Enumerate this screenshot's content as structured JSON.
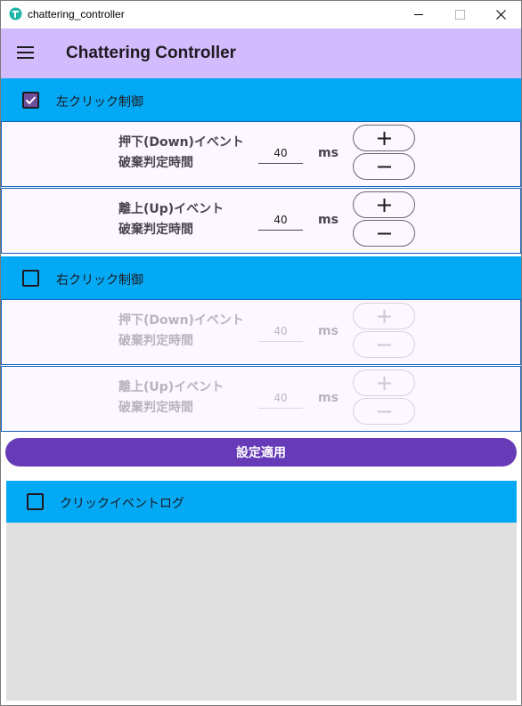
{
  "window": {
    "title": "chattering_controller",
    "icon": "app-logo-icon",
    "controls": [
      "minimize-icon",
      "maximize-icon",
      "close-icon"
    ]
  },
  "appbar": {
    "menu_icon": "menu-icon",
    "title": "Chattering Controller",
    "background": "#d3bcfd"
  },
  "left_click": {
    "label": "左クリック制御",
    "checked": true,
    "down": {
      "label_line1": "押下(Down)イベント",
      "label_line2": "破棄判定時間",
      "value": "40",
      "unit": "ms"
    },
    "up": {
      "label_line1": "離上(Up)イベント",
      "label_line2": "破棄判定時間",
      "value": "40",
      "unit": "ms"
    }
  },
  "right_click": {
    "label": "右クリック制御",
    "checked": false,
    "down": {
      "label_line1": "押下(Down)イベント",
      "label_line2": "破棄判定時間",
      "value": "40",
      "unit": "ms"
    },
    "up": {
      "label_line1": "離上(Up)イベント",
      "label_line2": "破棄判定時間",
      "value": "40",
      "unit": "ms"
    }
  },
  "apply": {
    "label": "設定適用"
  },
  "log": {
    "label": "クリックイベントログ",
    "checked": false
  },
  "colors": {
    "section_header": "#03a9f4",
    "primary": "#673ab7",
    "row_background": "#fdf7ff",
    "row_border": "#1565c0",
    "log_background": "#e0e0e0"
  }
}
